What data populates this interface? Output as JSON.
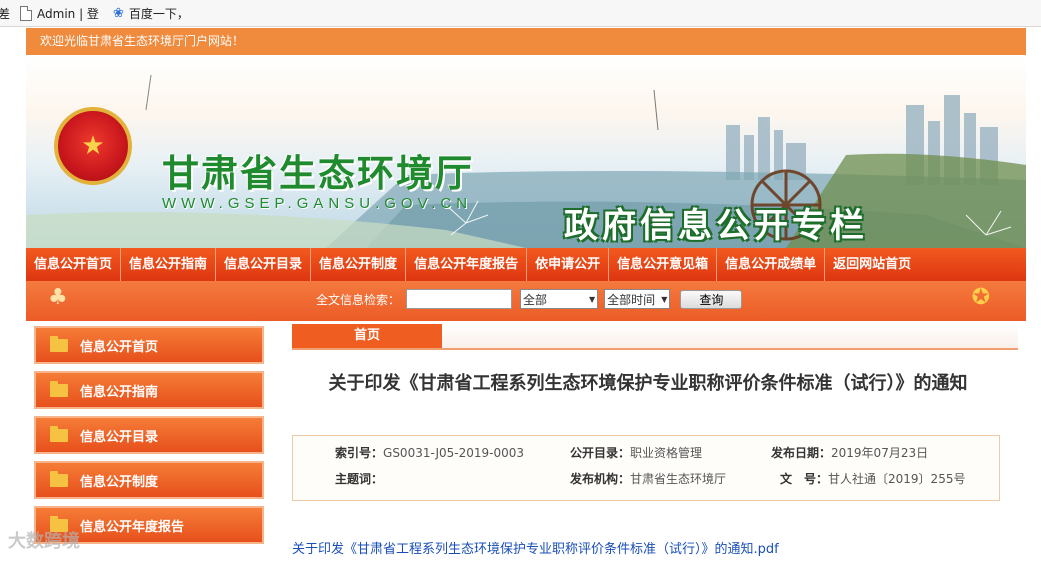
{
  "bookmarks": [
    {
      "label": "Admin | 登",
      "icon": "page-icon"
    },
    {
      "label": "百度一下，",
      "icon": "baidu-paw-icon"
    }
  ],
  "site": {
    "welcome": "欢迎光临甘肃省生态环境厅门户网站！",
    "title": "甘肃省生态环境厅",
    "url": "WWW.GSEP.GANSU.GOV.CN",
    "section_title": "政府信息公开专栏"
  },
  "nav": {
    "items": [
      "信息公开首页",
      "信息公开指南",
      "信息公开目录",
      "信息公开制度",
      "信息公开年度报告",
      "依申请公开",
      "信息公开意见箱",
      "信息公开成绩单",
      "返回网站首页"
    ]
  },
  "search": {
    "label": "全文信息检索：",
    "value": "",
    "category": "全部",
    "time": "全部时间",
    "button": "查询"
  },
  "sidebar": {
    "items": [
      "信息公开首页",
      "信息公开指南",
      "信息公开目录",
      "信息公开制度",
      "信息公开年度报告"
    ]
  },
  "content": {
    "tab": "首页",
    "title": "关于印发《甘肃省工程系列生态环境保护专业职称评价条件标准（试行）》的通知",
    "meta": {
      "index_label": "索引号：",
      "index_value": "GS0031-J05-2019-0003",
      "catalog_label": "公开目录：",
      "catalog_value": "职业资格管理",
      "date_label": "发布日期：",
      "date_value": "2019年07月23日",
      "subject_label": "主题词：",
      "subject_value": "",
      "org_label": "发布机构：",
      "org_value": "甘肃省生态环境厅",
      "doc_label": "文　号：",
      "doc_value": "甘人社通〔2019〕255号"
    },
    "attachment": "关于印发《甘肃省工程系列生态环境保护专业职称评价条件标准（试行）》的通知.pdf"
  },
  "watermark": "大数跨境",
  "colors": {
    "accent": "#ef5d20",
    "nav": "#e23d13",
    "title_green": "#1f8a2e",
    "link": "#1a4fb8"
  }
}
